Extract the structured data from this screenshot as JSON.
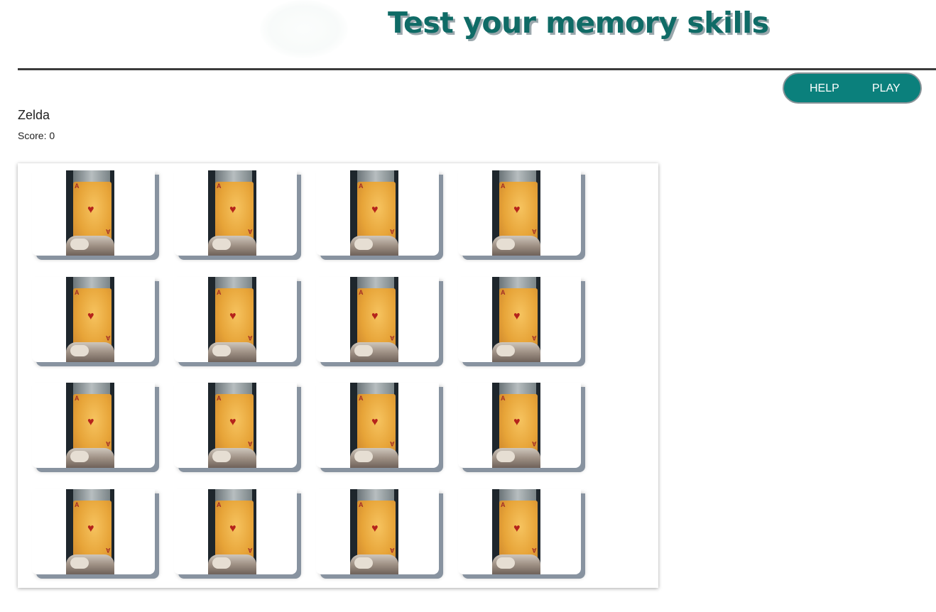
{
  "header": {
    "title": "Test your memory skills"
  },
  "nav": {
    "help_label": "HELP",
    "play_label": "PLAY"
  },
  "player": {
    "name": "Zelda",
    "score_text": "Score: 0"
  },
  "board": {
    "rows": 4,
    "cols": 4,
    "card_back": {
      "rank": "A",
      "suit_glyph": "♥",
      "icon": "ace-of-hearts-card-back"
    },
    "cards": [
      {
        "state": "face-down"
      },
      {
        "state": "face-down"
      },
      {
        "state": "face-down"
      },
      {
        "state": "face-down"
      },
      {
        "state": "face-down"
      },
      {
        "state": "face-down"
      },
      {
        "state": "face-down"
      },
      {
        "state": "face-down"
      },
      {
        "state": "face-down"
      },
      {
        "state": "face-down"
      },
      {
        "state": "face-down"
      },
      {
        "state": "face-down"
      },
      {
        "state": "face-down"
      },
      {
        "state": "face-down"
      },
      {
        "state": "face-down"
      },
      {
        "state": "face-down"
      }
    ]
  },
  "colors": {
    "brand": "#0b807c",
    "title": "#0f6b66",
    "title_shadow": "#9aa7ac",
    "card_shadow": "#8893a0",
    "heart": "#b5231b"
  }
}
